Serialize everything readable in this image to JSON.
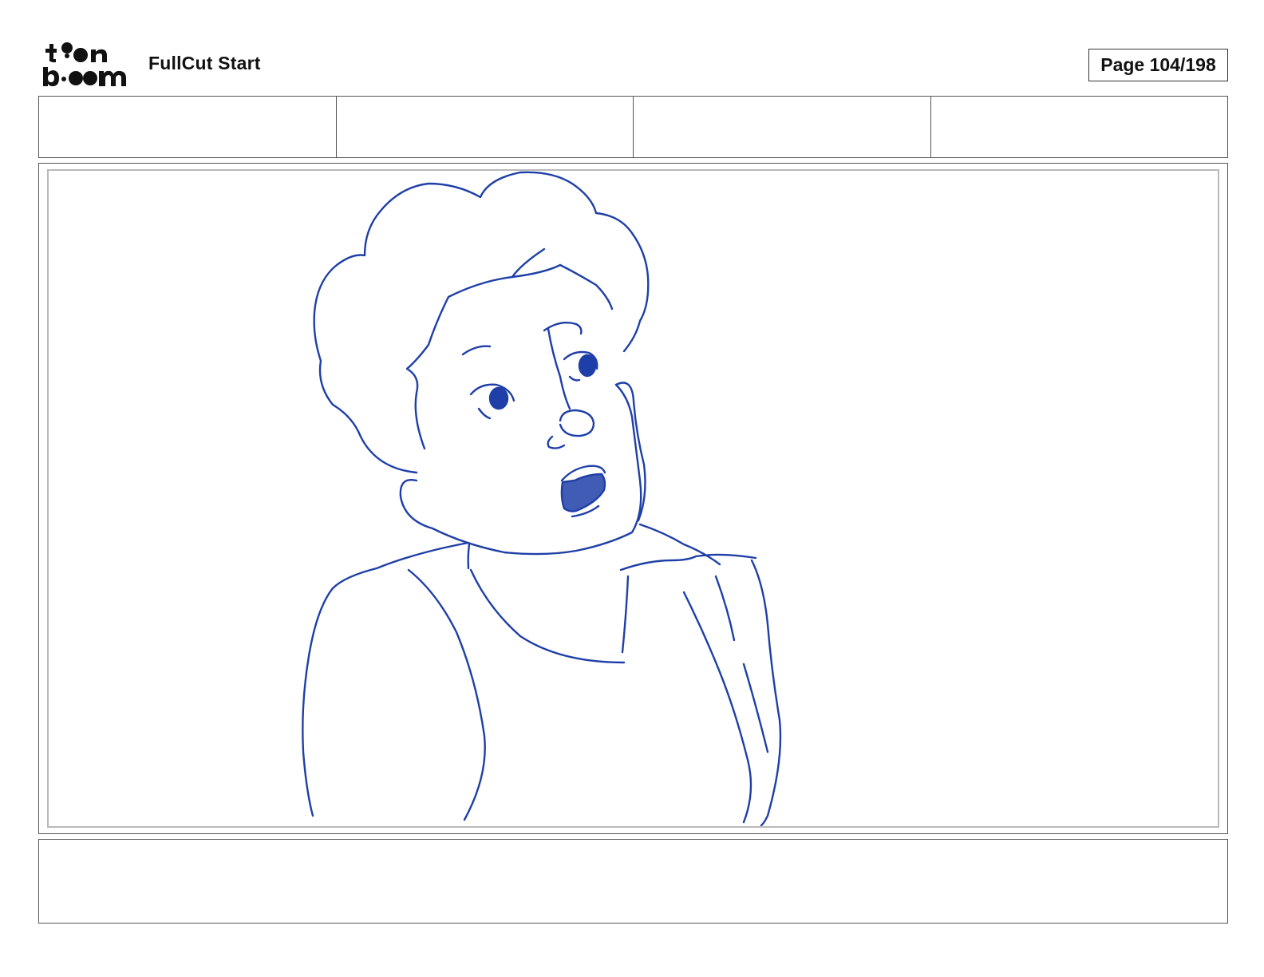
{
  "header": {
    "logo_alt": "toon boom",
    "project_title": "FullCut Start",
    "page_label": "Page 104/198"
  },
  "info_row": {
    "cells": [
      "",
      "",
      "",
      ""
    ]
  },
  "panel": {
    "sketch_color": "#1f3fa8",
    "subject": "sketch-character"
  },
  "notes": {
    "text": ""
  }
}
